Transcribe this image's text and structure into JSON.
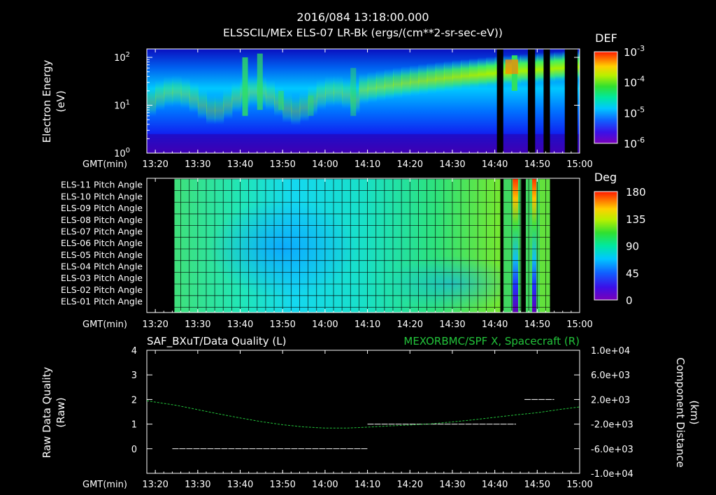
{
  "header": {
    "title": "2016/084 13:18:00.000",
    "subtitle": "ELSSCIL/MEx ELS-07 LR-Bk  (ergs/(cm**2-sr-sec-eV))"
  },
  "time_axis": {
    "label": "GMT(min)",
    "ticks": [
      "13:20",
      "13:30",
      "13:40",
      "13:50",
      "14:00",
      "14:10",
      "14:20",
      "14:30",
      "14:40",
      "14:50",
      "15:00"
    ],
    "tick_minutes": [
      20,
      30,
      40,
      50,
      60,
      70,
      80,
      90,
      100,
      110,
      120
    ],
    "range_minutes": [
      18,
      120
    ]
  },
  "colors": {
    "background": "#000000",
    "foreground": "#ffffff",
    "spacecraft_series": "#22c33a",
    "quality_series": "#ffffff"
  },
  "chart_data": [
    {
      "type": "heatmap",
      "ylabel_line1": "Electron Energy",
      "ylabel_line2": "(eV)",
      "y_scale": "log",
      "ylim": [
        1,
        150
      ],
      "y_ticks": [
        {
          "value": 1,
          "base": "10",
          "exp": "0"
        },
        {
          "value": 10,
          "base": "10",
          "exp": "1"
        },
        {
          "value": 100,
          "base": "10",
          "exp": "2"
        }
      ],
      "colorbar": {
        "title": "DEF",
        "scale": "log",
        "ticks": [
          {
            "value": 0.001,
            "base": "10",
            "exp": "-3"
          },
          {
            "value": 0.0001,
            "base": "10",
            "exp": "-4"
          },
          {
            "value": 1e-05,
            "base": "10",
            "exp": "-5"
          },
          {
            "value": 1e-06,
            "base": "10",
            "exp": "-6"
          }
        ]
      },
      "data_gaps_minutes": [
        [
          100.5,
          102.0
        ],
        [
          107.8,
          109.5
        ],
        [
          111.5,
          113.0
        ],
        [
          116.5,
          119.5
        ]
      ]
    },
    {
      "type": "heatmap",
      "rows": [
        "ELS-11 Pitch Angle",
        "ELS-10 Pitch Angle",
        "ELS-09 Pitch Angle",
        "ELS-08 Pitch Angle",
        "ELS-07 Pitch Angle",
        "ELS-06 Pitch Angle",
        "ELS-05 Pitch Angle",
        "ELS-04 Pitch Angle",
        "ELS-03 Pitch Angle",
        "ELS-02 Pitch Angle",
        "ELS-01 Pitch Angle"
      ],
      "data_start_minute": 24.5,
      "data_end_minute": 113.0,
      "data_gaps_minutes": [
        [
          104.2,
          105.5
        ],
        [
          108.8,
          109.8
        ]
      ],
      "colorbar": {
        "title": "Deg",
        "range": [
          0,
          180
        ],
        "ticks": [
          180,
          135,
          90,
          45,
          0
        ]
      }
    },
    {
      "type": "line",
      "title_left": "SAF_BXuT/Data Quality (L)",
      "title_right": "MEXORBMC/SPF X, Spacecraft (R)",
      "ylabel_left_line1": "Raw Data Quality",
      "ylabel_left_line2": "(Raw)",
      "ylabel_right_line1": "Component Distance",
      "ylabel_right_line2": "(km)",
      "ylim_left": [
        -1,
        4
      ],
      "yticks_left": [
        "4",
        "3",
        "2",
        "1",
        "0"
      ],
      "yticks_left_values": [
        4,
        3,
        2,
        1,
        0
      ],
      "ylim_right": [
        -10000,
        10000
      ],
      "yticks_right": [
        "1.0e+04",
        "6.0e+03",
        "2.0e+03",
        "-2.0e+03",
        "-6.0e+03",
        "-1.0e+04"
      ],
      "yticks_right_values": [
        10000,
        6000,
        2000,
        -2000,
        -6000,
        -10000
      ],
      "series": [
        {
          "axis": "left",
          "segments": [
            {
              "x": [
                24,
                70
              ],
              "y": [
                0,
                0
              ]
            },
            {
              "x": [
                70,
                105
              ],
              "y": [
                1,
                1
              ]
            },
            {
              "x": [
                107,
                114
              ],
              "y": [
                2,
                2
              ]
            }
          ]
        },
        {
          "axis": "right",
          "x": [
            18,
            25,
            30,
            35,
            40,
            45,
            50,
            55,
            60,
            65,
            70,
            75,
            80,
            85,
            90,
            95,
            100,
            105,
            110,
            115,
            120
          ],
          "y": [
            1800,
            1050,
            350,
            -350,
            -1000,
            -1600,
            -2100,
            -2450,
            -2650,
            -2650,
            -2500,
            -2300,
            -2150,
            -1950,
            -1650,
            -1300,
            -900,
            -500,
            -150,
            350,
            800
          ]
        }
      ]
    }
  ]
}
